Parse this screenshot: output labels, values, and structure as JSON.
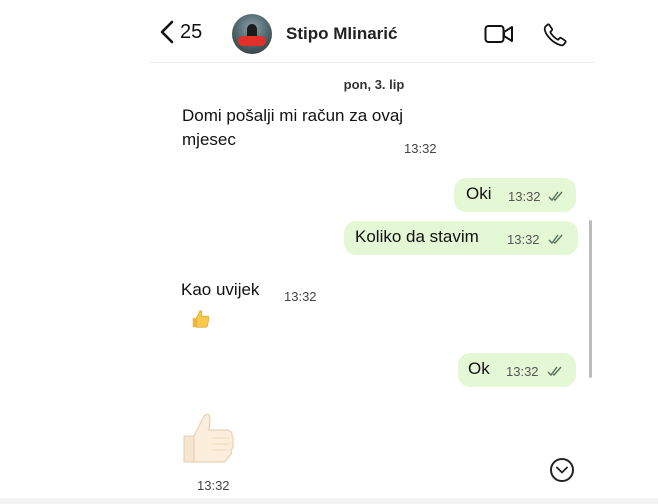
{
  "header": {
    "back_count": "25",
    "contact_name": "Stipo Mlinarić"
  },
  "date_separator": "pon, 3. lip",
  "messages": [
    {
      "direction": "in",
      "text_line1": "Domi pošalji mi račun za ovaj",
      "text_line2": "mjesec",
      "time": "13:32"
    },
    {
      "direction": "out",
      "text": "Oki",
      "time": "13:32",
      "status": "read"
    },
    {
      "direction": "out",
      "text": "Koliko da stavim",
      "time": "13:32",
      "status": "read"
    },
    {
      "direction": "in",
      "text": "Kao uvijek",
      "time": "13:32",
      "reaction": "thumbs-up-icon"
    },
    {
      "direction": "out",
      "text": "Ok",
      "time": "13:32",
      "status": "read"
    },
    {
      "direction": "in",
      "sticker": "thumbs-up-icon",
      "time": "13:32"
    }
  ],
  "colors": {
    "outgoing_bubble": "#e4f8d6",
    "read_ticks": "#55705a"
  }
}
